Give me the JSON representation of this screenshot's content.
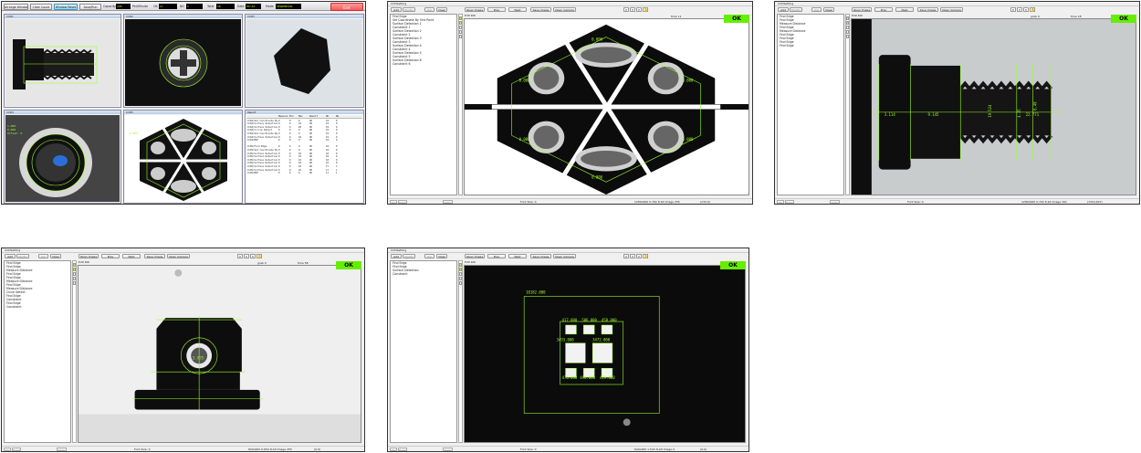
{
  "dashboard": {
    "toolbar": {
      "arrange_windows": "Arrange Windows",
      "clear_count": "Clear Count",
      "window_reset": "Window Reset",
      "save_run": "Save/Run",
      "capacity_label": "Capacity",
      "capacity_value": "120",
      "per_minute_label": "Per/Minute",
      "ok_label": "OK",
      "ok_value": "17",
      "ng_label": "NG",
      "ng_value": "1",
      "total_label": "Total",
      "total_value": "18",
      "date_label": "Date",
      "date_value": "04:44",
      "mode_label": "Mode",
      "mode_value": "SEQUENTIAL",
      "exit": "Exit"
    },
    "panes": {
      "ccd1": "CCD1",
      "ccd2": "CCD2",
      "ccd3": "CCD3",
      "ccd4": "CCD4",
      "ccd5": "CCD5",
      "report": "Report"
    },
    "ccd4_overlay": [
      "1.000",
      "0.000",
      "Offset: 0"
    ],
    "ccd5_overlay": "0.000",
    "report": {
      "headers": [
        "",
        "Measure",
        "Min",
        "Max",
        "Result",
        "OK",
        "NG"
      ],
      "rows": [
        [
          "CCD4/Set Coordinate By",
          "0",
          "0",
          "0",
          "OK",
          "19",
          "0"
        ],
        [
          "CCD4/Surface Detection",
          "0",
          "0",
          "10",
          "OK",
          "19",
          "0"
        ],
        [
          "CCD4/Surface Detection",
          "0",
          "0",
          "20",
          "OK",
          "19",
          "0"
        ],
        [
          "CCD4/Circle Detect",
          "0",
          "0",
          "0",
          "OK",
          "19",
          "0"
        ],
        [
          "CCD4/Set Coordinate By",
          "0",
          "0",
          "0",
          "OK",
          "19",
          "0"
        ],
        [
          "CCD4/Surface Detection",
          "0",
          "0",
          "10",
          "OK",
          "19",
          "0"
        ],
        [
          "CCD4/BSF",
          "0",
          "0",
          "0",
          "OK",
          "19",
          "0"
        ],
        [
          "",
          "",
          "",
          "",
          "",
          "",
          ""
        ],
        [
          "CCD5/Find Edge",
          "0",
          "0",
          "0",
          "OK",
          "18",
          "0"
        ],
        [
          "CCD5/Set Coordinate By",
          "0",
          "0",
          "0",
          "OK",
          "18",
          "0"
        ],
        [
          "CCD5/Surface Detection",
          "0",
          "0",
          "10",
          "OK",
          "18",
          "0"
        ],
        [
          "CCD5/Surface Detection",
          "0",
          "0",
          "10",
          "OK",
          "18",
          "0"
        ],
        [
          "CCD5/Surface Detection",
          "0",
          "0",
          "10",
          "OK",
          "18",
          "0"
        ],
        [
          "CCD5/Surface Detection",
          "0",
          "0",
          "10",
          "OK",
          "16",
          "0"
        ],
        [
          "CCD5/Surface Detection",
          "0",
          "0",
          "10",
          "OK",
          "17",
          "1"
        ],
        [
          "CCD5/Surface Detection",
          "0",
          "0",
          "10",
          "OK",
          "17",
          "1"
        ],
        [
          "CCD5/BSF",
          "0",
          "0",
          "0",
          "OK",
          "17",
          "1"
        ]
      ]
    }
  },
  "setting": {
    "title": "CCDSetting",
    "add": "Add",
    "modify": "Modify",
    "del": "Del",
    "clear": "Clear",
    "open_image": "Open Image",
    "prev": "Prev",
    "next": "Next",
    "save_image": "Save Image",
    "open_camera": "Open Camera",
    "edit_roi": "Edit ROI",
    "up": "Up",
    "down": "Down",
    "copy": "Copy",
    "ok": "OK",
    "font_size": "Font Size: 0",
    "time_label": "time",
    "grab_label": "grab"
  },
  "windows": [
    {
      "id": "w1",
      "list": [
        "Find Edge",
        "Set Coordinate By One Point",
        "Surface Detection 1",
        "Constraint 1",
        "Surface Detection 2",
        "Constraint 2",
        "Surface Detection 3",
        "Constraint 3",
        "Surface Detection 4",
        "Constraint 4",
        "Surface Detection 5",
        "Constraint 5",
        "Surface Detection 6",
        "Constraint 6"
      ],
      "time": "11",
      "status": "1280x960 0.76X 8-bit Image 255",
      "coord": "(232,0)",
      "labels": [
        "0.000",
        "0.000",
        "0.000",
        "0.000",
        "0.000",
        "0.000"
      ]
    },
    {
      "id": "w2",
      "list": [
        "Find Edge",
        "Find Edge",
        "Measure Distance",
        "Find Edge",
        "Measure Distance",
        "Find Edge",
        "Find Edge",
        "Find Edge",
        "Find Edge"
      ],
      "grab": "0",
      "time": "18",
      "status": "1280x960 0.70X 8-bit Image 164",
      "coord": "(1504,607)",
      "labels": [
        "3.114",
        "9.145",
        "19.524",
        "22.771",
        "6.49",
        "4.35"
      ]
    },
    {
      "id": "w3",
      "list": [
        "Find Edge",
        "Find Edge",
        "Measure Distance",
        "Find Edge",
        "Find Edge",
        "Measure Distance",
        "Find Edge",
        "Measure Distance",
        "Circle Detect",
        "Find Edge",
        "Constraint",
        "Find Edge",
        "Constraint"
      ],
      "grab": "0",
      "time": "58",
      "status": "800x600 0.65X 8-bit Image 255",
      "coord": "(0,0)",
      "labels": [
        "5.975"
      ]
    },
    {
      "id": "w4",
      "list": [
        "Find Edge",
        "Find Edge",
        "Surface Detection",
        "Constraint"
      ],
      "status": "640x480 1.52X 8-bit Image 0",
      "coord": "(0,0)",
      "labels": [
        "10182.000",
        "417.000",
        "506.000",
        "458.000",
        "3493.000",
        "3472.000",
        "476.000",
        "496.000",
        "419.000"
      ]
    }
  ]
}
